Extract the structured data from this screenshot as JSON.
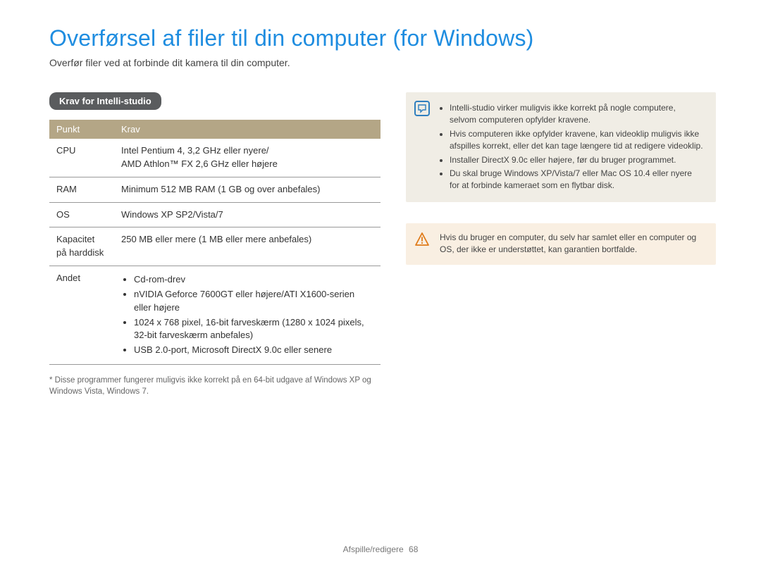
{
  "title": "Overførsel af filer til din computer (for Windows)",
  "subtitle": "Overfør filer ved at forbinde dit kamera til din computer.",
  "section_label": "Krav for Intelli-studio",
  "table": {
    "headers": {
      "col1": "Punkt",
      "col2": "Krav"
    },
    "rows": {
      "cpu": {
        "label": "CPU",
        "value": "Intel Pentium 4, 3,2 GHz eller nyere/\nAMD Athlon™ FX 2,6 GHz eller højere"
      },
      "ram": {
        "label": "RAM",
        "value": "Minimum 512 MB RAM (1 GB og over anbefales)"
      },
      "os": {
        "label": "OS",
        "value": "Windows XP SP2/Vista/7"
      },
      "hdd": {
        "label": "Kapacitet på harddisk",
        "value": "250 MB eller mere (1 MB eller mere anbefales)"
      },
      "other_label": "Andet",
      "other_items": {
        "0": "Cd-rom-drev",
        "1": "nVIDIA Geforce 7600GT eller højere/ATI X1600-serien eller højere",
        "2": "1024 x 768 pixel, 16-bit farveskærm (1280 x 1024 pixels, 32-bit farveskærm anbefales)",
        "3": "USB 2.0-port, Microsoft DirectX 9.0c eller senere"
      }
    }
  },
  "footnote": "* Disse programmer fungerer muligvis ikke korrekt på en 64-bit udgave af Windows XP og Windows Vista, Windows 7.",
  "info_notes": {
    "0": "Intelli-studio virker muligvis ikke korrekt på nogle computere, selvom computeren opfylder kravene.",
    "1": "Hvis computeren ikke opfylder kravene, kan videoklip muligvis ikke afspilles korrekt, eller det kan tage længere tid at redigere videoklip.",
    "2": "Installer DirectX 9.0c eller højere, før du bruger programmet.",
    "3": "Du skal bruge Windows XP/Vista/7 eller Mac OS 10.4 eller nyere for at forbinde kameraet som en flytbar disk."
  },
  "warn_note": "Hvis du bruger en computer, du selv har samlet eller en computer og OS, der ikke er understøttet, kan garantien bortfalde.",
  "footer": {
    "section": "Afspille/redigere",
    "page": "68"
  }
}
